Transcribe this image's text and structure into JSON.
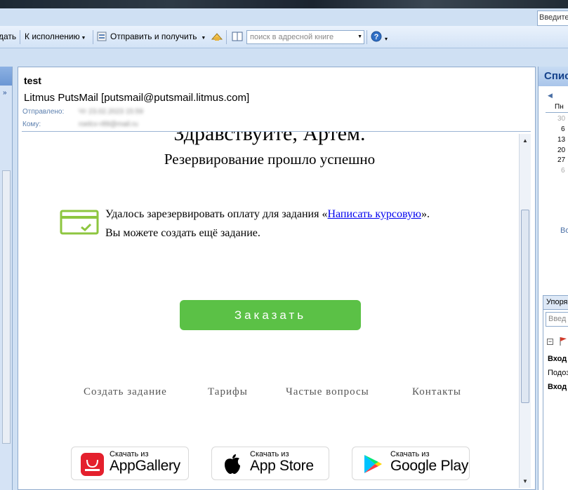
{
  "help_box": {
    "placeholder": "Введите"
  },
  "toolbar": {
    "reply_fragment": "дать",
    "followup_label": "К исполнению",
    "send_receive_label": "Отправить и получить",
    "search_placeholder": "поиск в адресной книге"
  },
  "message": {
    "subject": "test",
    "from": "Litmus PutsMail [putsmail@putsmail.litmus.com]",
    "sent_label": "Отправлено:",
    "sent_value": "Чт 23.02.2023 15:59",
    "to_label": "Кому:",
    "to_value": "roelcv-r89@mail.ru"
  },
  "email": {
    "greeting": "Здравствуйте, Артем.",
    "subtitle": "Резервирование прошло успешно",
    "line1_prefix": "Удалось зарезервировать оплату для задания «",
    "line1_link": "Написать курсовую",
    "line1_suffix": "».",
    "line2": "Вы можете создать ещё задание.",
    "order_button": "Заказать",
    "footer_links": [
      "Создать задание",
      "Тарифы",
      "Частые вопросы",
      "Контакты"
    ],
    "stores": [
      {
        "small": "Скачать из",
        "big": "AppGallery"
      },
      {
        "small": "Скачать из",
        "big": "App Store"
      },
      {
        "small": "Скачать из",
        "big": "Google Play"
      }
    ]
  },
  "right_pane": {
    "title": "Спис",
    "weekday": "Пн",
    "dates": [
      "30",
      "6",
      "13",
      "20",
      "27",
      "6"
    ],
    "vo": "Во",
    "sort_label": "Упоря",
    "search_placeholder": "Введ",
    "items": [
      "Вход",
      "Подоз",
      "Вход"
    ]
  },
  "colors": {
    "accent_green": "#5bc146",
    "link": "#0000ee",
    "header_blue": "#15428b"
  }
}
